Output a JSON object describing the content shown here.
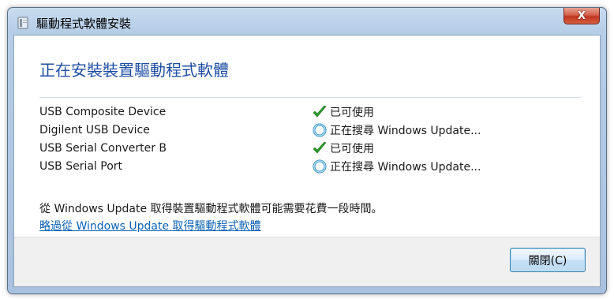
{
  "window": {
    "title": "驅動程式軟體安裝",
    "close_label": "X"
  },
  "heading": "正在安裝裝置驅動程式軟體",
  "devices": [
    {
      "name": "USB Composite Device",
      "status": "已可使用",
      "status_icon": "check-icon"
    },
    {
      "name": "Digilent USB Device",
      "status": "正在搜尋 Windows Update...",
      "status_icon": "searching-icon"
    },
    {
      "name": "USB Serial Converter B",
      "status": "已可使用",
      "status_icon": "check-icon"
    },
    {
      "name": "USB Serial Port",
      "status": "正在搜尋 Windows Update...",
      "status_icon": "searching-icon"
    }
  ],
  "info": "從 Windows Update 取得裝置驅動程式軟體可能需要花費一段時間。",
  "skip_link": "略過從 Windows Update 取得驅動程式軟體",
  "footer": {
    "close_button": "關閉(C)"
  },
  "colors": {
    "heading": "#1f4ea3",
    "link": "#0b62b5",
    "check": "#2e9a2e",
    "searching": "#2d8fcc"
  }
}
